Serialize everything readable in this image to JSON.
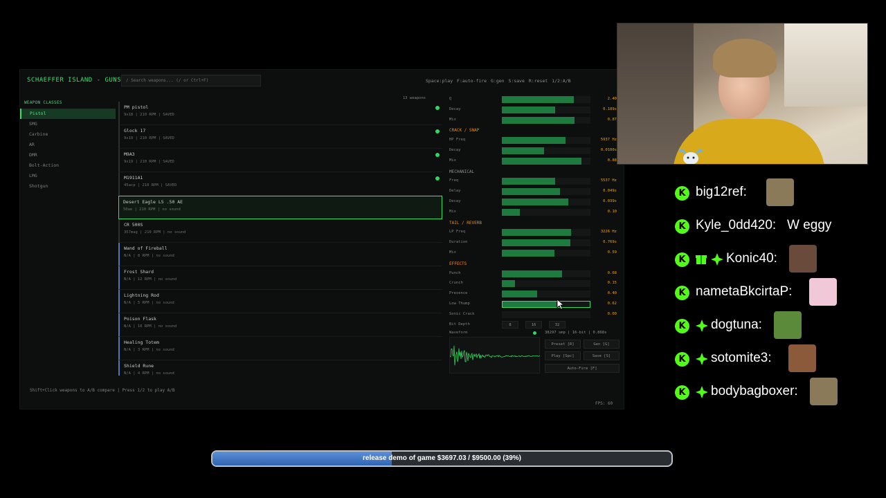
{
  "app": {
    "title": "SCHAEFFER ISLAND - GUNS",
    "search_placeholder": "/ Search weapons... (/ or Ctrl+F)",
    "hotkeys": "Space:play F:auto-fire G:gen S:save R:reset 1/2:A/B",
    "sidebar": {
      "heading": "WEAPON CLASSES",
      "items": [
        {
          "label": "Pistol",
          "active": true
        },
        {
          "label": "SMG"
        },
        {
          "label": "Carbine"
        },
        {
          "label": "AR"
        },
        {
          "label": "DMR"
        },
        {
          "label": "Bolt-Action"
        },
        {
          "label": "LMG"
        },
        {
          "label": "Shotgun"
        }
      ]
    },
    "weapon_count": "13 weapons",
    "weapons": [
      {
        "name": "PM pistol",
        "sub": "9x18 | 210 RPM | SAVED",
        "saved": true
      },
      {
        "name": "Glock 17",
        "sub": "9x19 | 210 RPM | SAVED",
        "saved": true
      },
      {
        "name": "M9A3",
        "sub": "9x19 | 210 RPM | SAVED",
        "saved": true
      },
      {
        "name": "M1911A1",
        "sub": "45acp | 210 RPM | SAVED",
        "saved": true
      },
      {
        "name": "Desert Eagle L5 .50 AE",
        "sub": "50ae | 210 RPM | no sound",
        "selected": true
      },
      {
        "name": "CR 500S",
        "sub": "357mag | 210 RPM | no sound"
      },
      {
        "name": "Wand of Fireball",
        "sub": "N/A | 8 RPM | no sound",
        "magic": true
      },
      {
        "name": "Frost Shard",
        "sub": "N/A | 12 RPM | no sound",
        "magic": true
      },
      {
        "name": "Lightning Rod",
        "sub": "N/A | 5 RPM | no sound",
        "magic": true
      },
      {
        "name": "Poison Flask",
        "sub": "N/A | 10 RPM | no sound",
        "magic": true
      },
      {
        "name": "Healing Totem",
        "sub": "N/A | 3 RPM | no sound",
        "magic": true
      },
      {
        "name": "Shield Rune",
        "sub": "N/A | 4 RPM | no sound",
        "magic": true
      }
    ],
    "params": [
      {
        "label": "Q",
        "value": "2.40",
        "fill": 0.81
      },
      {
        "label": "Decay",
        "value": "0.189s",
        "fill": 0.6
      },
      {
        "label": "Mix",
        "value": "0.87",
        "fill": 0.82
      },
      {
        "section": "CRACK / SNAP"
      },
      {
        "label": "HP Freq",
        "value": "5937 Hz",
        "fill": 0.72
      },
      {
        "label": "Decay",
        "value": "0.0100s",
        "fill": 0.48
      },
      {
        "label": "Mix",
        "value": "0.88",
        "fill": 0.9
      },
      {
        "section": "MECHANICAL",
        "gray": true
      },
      {
        "label": "Freq",
        "value": "5537 Hz",
        "fill": 0.6
      },
      {
        "label": "Delay",
        "value": "0.049s",
        "fill": 0.66
      },
      {
        "label": "Decay",
        "value": "0.039s",
        "fill": 0.75
      },
      {
        "label": "Mix",
        "value": "0.10",
        "fill": 0.2
      },
      {
        "section": "TAIL / REVERB"
      },
      {
        "label": "LP Freq",
        "value": "3226 Hz",
        "fill": 0.78
      },
      {
        "label": "Duration",
        "value": "0.769s",
        "fill": 0.77
      },
      {
        "label": "Mix",
        "value": "0.59",
        "fill": 0.59
      },
      {
        "section": "EFFECTS"
      },
      {
        "label": "Punch",
        "value": "0.68",
        "fill": 0.68
      },
      {
        "label": "Crunch",
        "value": "0.15",
        "fill": 0.15
      },
      {
        "label": "Presence",
        "value": "0.40",
        "fill": 0.4
      },
      {
        "label": "Low Thump",
        "value": "0.62",
        "fill": 0.62,
        "highlight": true
      },
      {
        "label": "Sonic Crack",
        "value": "0.00",
        "fill": 0
      }
    ],
    "bit_depth": {
      "label": "Bit Depth",
      "options": [
        "8",
        "16",
        "32"
      ]
    },
    "waveform": {
      "label": "Waveform",
      "info": "38297 smp | 16-bit | 0.868s"
    },
    "actions": {
      "preset": "Preset [R]",
      "gen": "Gen [G]",
      "play": "Play [Spc]",
      "save": "Save [S]",
      "autofire": "Auto-Fire [F]"
    },
    "footer_hint": "Shift+Click weapons to A/B compare | Press 1/2 to play A/B",
    "fps": "FPS: 60"
  },
  "chat": [
    {
      "user": "big12ref:",
      "msg": "",
      "gift": false,
      "star": false
    },
    {
      "user": "Kyle_0dd420:",
      "msg": "W eggy",
      "gift": false,
      "star": false
    },
    {
      "user": "Konic40:",
      "msg": "",
      "gift": true,
      "star": true
    },
    {
      "user": "nametaBkcirtaP:",
      "msg": "",
      "gift": false,
      "star": false
    },
    {
      "user": "dogtuna:",
      "msg": "",
      "gift": false,
      "star": true
    },
    {
      "user": "sotomite3:",
      "msg": "",
      "gift": false,
      "star": true
    },
    {
      "user": "bodybagboxer:",
      "msg": "",
      "gift": false,
      "star": true
    }
  ],
  "goal": {
    "text": "release demo of game $3697.03 / $9500.00 (39%)",
    "progress": 0.39
  }
}
